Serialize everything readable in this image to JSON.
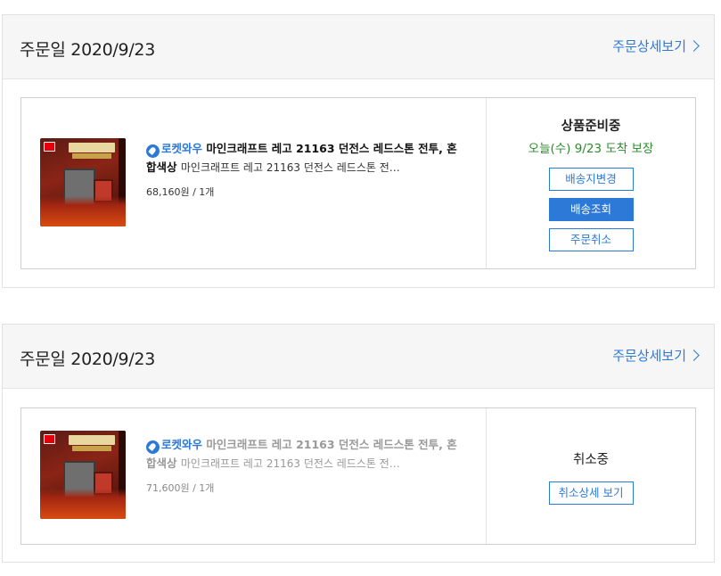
{
  "orders": [
    {
      "date": "주문일 2020/9/23",
      "detail_link": "주문상세보기",
      "item": {
        "badge": "로켓와우",
        "name": "마인크래프트 레고 21163 던전스 레드스톤 전투, 혼합색상",
        "option": "마인크래프트 레고 21163 던전스 레드스톤 전…",
        "price": "68,160원 / 1개"
      },
      "status": "상품준비중",
      "delivery": "오늘(수) 9/23 도착 보장",
      "buttons": [
        "배송지변경",
        "배송조회",
        "주문취소"
      ]
    },
    {
      "date": "주문일 2020/9/23",
      "detail_link": "주문상세보기",
      "item": {
        "badge": "로켓와우",
        "name": "마인크래프트 레고 21163 던전스 레드스톤 전투, 혼합색상",
        "option": "마인크래프트 레고 21163 던전스 레드스톤 전…",
        "price": "71,600원 / 1개"
      },
      "status": "취소중",
      "buttons": [
        "취소상세 보기"
      ]
    }
  ],
  "colors": {
    "accent": "#2d79d8",
    "delivery_green": "#2c8a2c",
    "header_bg": "#f6f6f6",
    "border": "#cfcfcf"
  }
}
